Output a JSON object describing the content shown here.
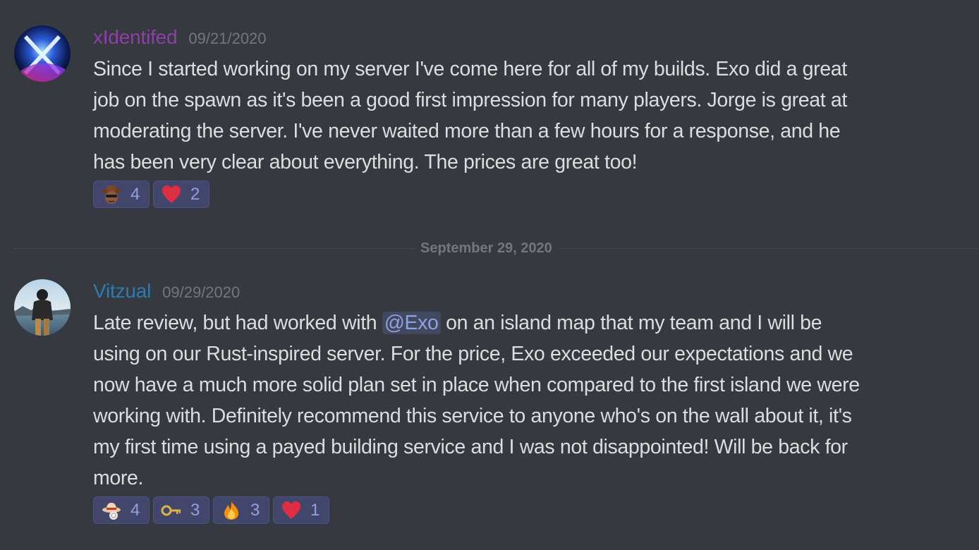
{
  "messages": [
    {
      "username": "xIdentifed",
      "timestamp": "09/21/2020",
      "lines": [
        "Since I started working on my server I've come here for all of my builds. Exo did a great",
        "job on the spawn as it's been a good first impression for many players. Jorge is great at",
        "moderating the server. I've never waited more than a few hours for a response, and he",
        "has been very clear about everything. The prices are great too!"
      ],
      "reactions": [
        {
          "emoji": "cowboy-sunglasses-emoji",
          "count": "4"
        },
        {
          "emoji": "heart-emoji",
          "count": "2"
        }
      ]
    },
    {
      "username": "Vitzual",
      "timestamp": "09/29/2020",
      "line1_before": "Late review, but had worked with ",
      "mention": "@Exo",
      "line1_after": " on an island map that my team and I will be",
      "lines": [
        "using on our Rust-inspired server. For the price, Exo exceeded our expectations and we",
        "now have a much more solid plan set in place when compared to the first island we were",
        "working with. Definitely recommend this service to anyone who's on the wall about it, it's",
        "my first time using a payed building service and I was not disappointed! Will be back for",
        "more."
      ],
      "reactions": [
        {
          "emoji": "hat-emoji",
          "count": "4"
        },
        {
          "emoji": "key-emoji",
          "count": "3"
        },
        {
          "emoji": "fire-emoji",
          "count": "3"
        },
        {
          "emoji": "heart-emoji",
          "count": "1"
        }
      ]
    }
  ],
  "date_divider": "September 29, 2020",
  "colors": {
    "background": "#36393f",
    "username_1": "#8e3fa8",
    "username_2": "#2c7cb0",
    "mention": "#8ea1e1"
  }
}
